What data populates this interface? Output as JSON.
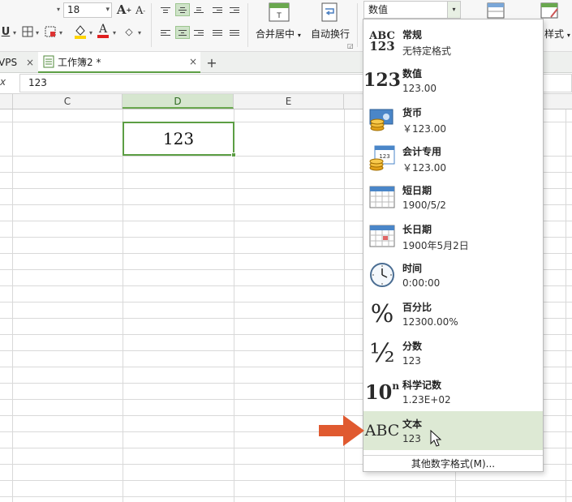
{
  "ribbon": {
    "font_size": "18",
    "bold_label": "U",
    "merge_center_label": "合并居中",
    "wrap_text_label": "自动换行",
    "number_format_value": "数值",
    "styles_label": "样式"
  },
  "tabs": [
    {
      "label": "VPS",
      "close": "×"
    },
    {
      "label": "工作簿2 *",
      "close": "×"
    }
  ],
  "new_tab_label": "+",
  "formula_bar": {
    "fx_label": "x",
    "value": "123"
  },
  "columns": [
    "C",
    "D",
    "E"
  ],
  "selected_cell": {
    "value": "123"
  },
  "number_formats": [
    {
      "icon": "general-icon",
      "name": "常规",
      "example": "无特定格式"
    },
    {
      "icon": "number-icon",
      "name": "数值",
      "example": "123.00"
    },
    {
      "icon": "currency-icon",
      "name": "货币",
      "example": "￥123.00"
    },
    {
      "icon": "accounting-icon",
      "name": "会计专用",
      "example": " ￥123.00"
    },
    {
      "icon": "short-date-icon",
      "name": "短日期",
      "example": "1900/5/2"
    },
    {
      "icon": "long-date-icon",
      "name": "长日期",
      "example": "1900年5月2日"
    },
    {
      "icon": "clock-icon",
      "name": "时间",
      "example": "0:00:00"
    },
    {
      "icon": "percent-icon",
      "name": "百分比",
      "example": "12300.00%"
    },
    {
      "icon": "fraction-icon",
      "name": "分数",
      "example": "123"
    },
    {
      "icon": "scientific-icon",
      "name": "科学记数",
      "example": "1.23E+02"
    },
    {
      "icon": "text-icon",
      "name": "文本",
      "example": "123"
    }
  ],
  "glyphs": {
    "general_top": "ABC",
    "general_bottom": "123",
    "number": "123",
    "percent": "%",
    "fraction": "½",
    "sci_base": "10",
    "sci_exp": "n",
    "text_abc": "ABC",
    "calendar_num": "123"
  },
  "more_formats_label": "其他数字格式(M)...",
  "colors": {
    "accent": "#5c9e44",
    "highlight_row": "#dde9d4",
    "arrow": "#e05a30"
  }
}
